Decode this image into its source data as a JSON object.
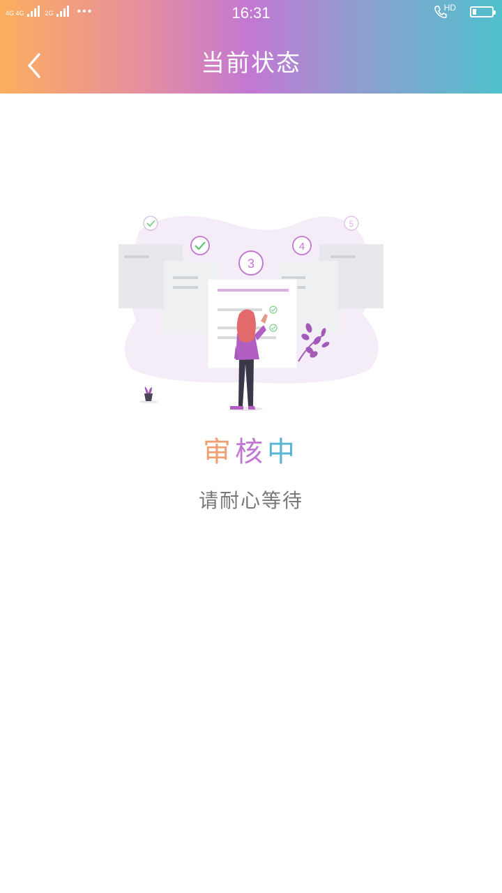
{
  "status_bar": {
    "network_1": "4G 4G",
    "network_2": "2G",
    "time": "16:31",
    "hd": "HD",
    "icons": [
      "signal-icon",
      "more-dots-icon",
      "volte-call-icon",
      "battery-icon"
    ],
    "battery_level": 0.2
  },
  "header": {
    "title": "当前状态",
    "back_icon": "chevron-left-icon",
    "gradient": [
      "#fcae5e",
      "#c278d2",
      "#4fc0cc"
    ]
  },
  "illustration": {
    "steps": [
      {
        "label": "",
        "state": "done"
      },
      {
        "label": "",
        "state": "done"
      },
      {
        "label": "3",
        "state": "current"
      },
      {
        "label": "4",
        "state": "pending"
      },
      {
        "label": "5",
        "state": "pending"
      }
    ],
    "accent": "#c278d2"
  },
  "status": {
    "title_chars": [
      "审",
      "核",
      "中"
    ],
    "title_colors": [
      "#f0a070",
      "#c278d2",
      "#5ab4d2"
    ],
    "subtitle": "请耐心等待"
  }
}
